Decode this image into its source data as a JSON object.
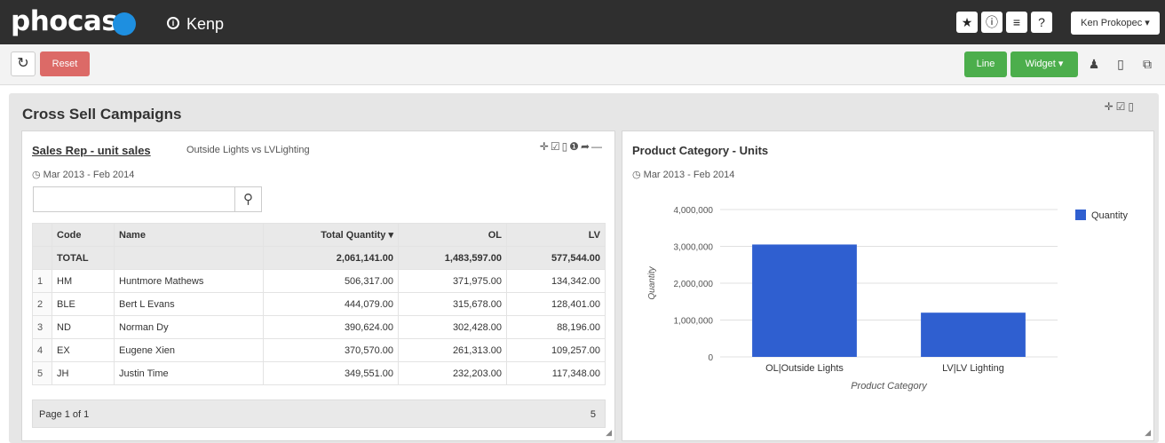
{
  "app": {
    "logo": "phocas",
    "dashboard_name": "Kenp",
    "user": "Ken Prokopec ▾",
    "top_icons": [
      "star-icon",
      "info-icon",
      "database-icon",
      "help-icon"
    ]
  },
  "toolbar": {
    "reset_label": "Reset",
    "line_label": "Line",
    "widget_label": "Widget ▾",
    "right_icons": [
      "users-icon",
      "trash-icon",
      "copy-icon"
    ]
  },
  "dashboard": {
    "title": "Cross Sell Campaigns"
  },
  "grid_widget": {
    "title": "Sales Rep - unit sales",
    "subtitle": "Outside Lights vs LVLighting",
    "date_range": "Mar 2013 - Feb 2014",
    "search_placeholder": "",
    "columns": [
      "Code",
      "Name",
      "Total Quantity ▾",
      "OL",
      "LV"
    ],
    "total_row": {
      "label": "TOTAL",
      "total": "2,061,141.00",
      "ol": "1,483,597.00",
      "lv": "577,544.00"
    },
    "rows": [
      {
        "n": "1",
        "code": "HM",
        "name": "Huntmore Mathews",
        "total": "506,317.00",
        "ol": "371,975.00",
        "lv": "134,342.00"
      },
      {
        "n": "2",
        "code": "BLE",
        "name": "Bert L Evans",
        "total": "444,079.00",
        "ol": "315,678.00",
        "lv": "128,401.00"
      },
      {
        "n": "3",
        "code": "ND",
        "name": "Norman Dy",
        "total": "390,624.00",
        "ol": "302,428.00",
        "lv": "88,196.00"
      },
      {
        "n": "4",
        "code": "EX",
        "name": "Eugene Xien",
        "total": "370,570.00",
        "ol": "261,313.00",
        "lv": "109,257.00"
      },
      {
        "n": "5",
        "code": "JH",
        "name": "Justin Time",
        "total": "349,551.00",
        "ol": "232,203.00",
        "lv": "117,348.00"
      }
    ],
    "pager": "Page 1 of 1",
    "count": "5"
  },
  "chart_widget": {
    "title": "Product Category - Units",
    "date_range": "Mar 2013 - Feb 2014"
  },
  "chart_data": {
    "type": "bar",
    "categories": [
      "OL|Outside Lights",
      "LV|LV Lighting"
    ],
    "series": [
      {
        "name": "Quantity",
        "values": [
          3050000,
          1200000
        ],
        "color": "#2f5fd0"
      }
    ],
    "xlabel": "Product Category",
    "ylabel": "Quantity",
    "ylim": [
      0,
      4000000
    ],
    "yticks": [
      0,
      1000000,
      2000000,
      3000000,
      4000000
    ],
    "ytick_labels": [
      "0",
      "1,000,000",
      "2,000,000",
      "3,000,000",
      "4,000,000"
    ],
    "grid": true,
    "legend": "top-right"
  }
}
